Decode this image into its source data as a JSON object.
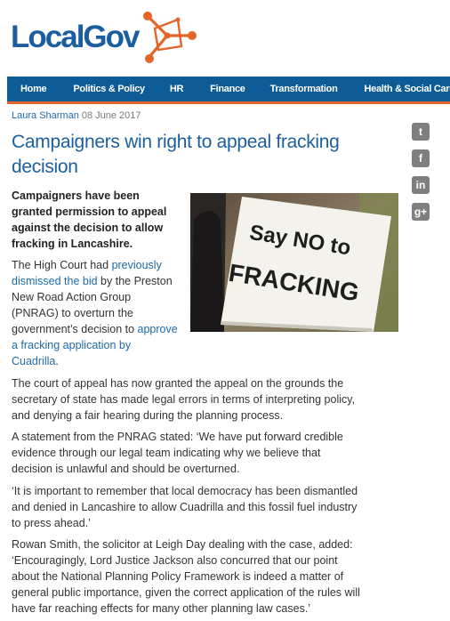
{
  "brand": {
    "logo_text": "LocalGov"
  },
  "nav": {
    "items": [
      "Home",
      "Politics & Policy",
      "HR",
      "Finance",
      "Transformation",
      "Health & Social Care"
    ]
  },
  "article": {
    "author": "Laura Sharman",
    "date": "08 June 2017",
    "title": "Campaigners win right to appeal fracking decision",
    "lead": "Campaigners have been granted permission to appeal against the decision to allow fracking in Lancashire.",
    "p1": {
      "a": "The High Court had ",
      "link1": "previously dismissed the bid",
      "b": " by the Preston New Road Action Group (PNRAG) to overturn the government’s decision to ",
      "link2": "approve a fracking application by Cuadrilla",
      "c": "."
    },
    "p2": "The court of appeal has now granted the appeal on the grounds the secretary of state has made legal errors in terms of interpreting policy, and denying a fair hearing during the planning process.",
    "p3": "A statement from the PNRAG stated: ‘We have put forward credible evidence through our legal team indicating why we believe that decision is unlawful and should be overturned.",
    "p4": "‘It is important to remember that local democracy has been dismantled and denied in Lancashire to allow Cuadrilla and this fossil fuel industry to press ahead.’",
    "p5": "Rowan Smith, the solicitor at Leigh Day dealing with the case, added: ‘Encouragingly, Lord Justice Jackson also concurred that our point about the National Planning Policy Framework is indeed a matter of general public importance, given the correct application of the rules will have far reaching effects for many other planning law cases.’"
  },
  "image": {
    "sign_line1": "Say NO to",
    "sign_line2": "FRACKING"
  },
  "social": {
    "icons": [
      "twitter-icon",
      "facebook-icon",
      "linkedin-icon",
      "google-plus-icon"
    ],
    "glyphs": [
      "t",
      "f",
      "in",
      "g+"
    ]
  },
  "colors": {
    "brand_blue": "#1b5e9f",
    "nav_bg": "#0d5c97",
    "nav_accent": "#e4642a",
    "link": "#1f6aa8",
    "logo_orange": "#e4642a"
  }
}
